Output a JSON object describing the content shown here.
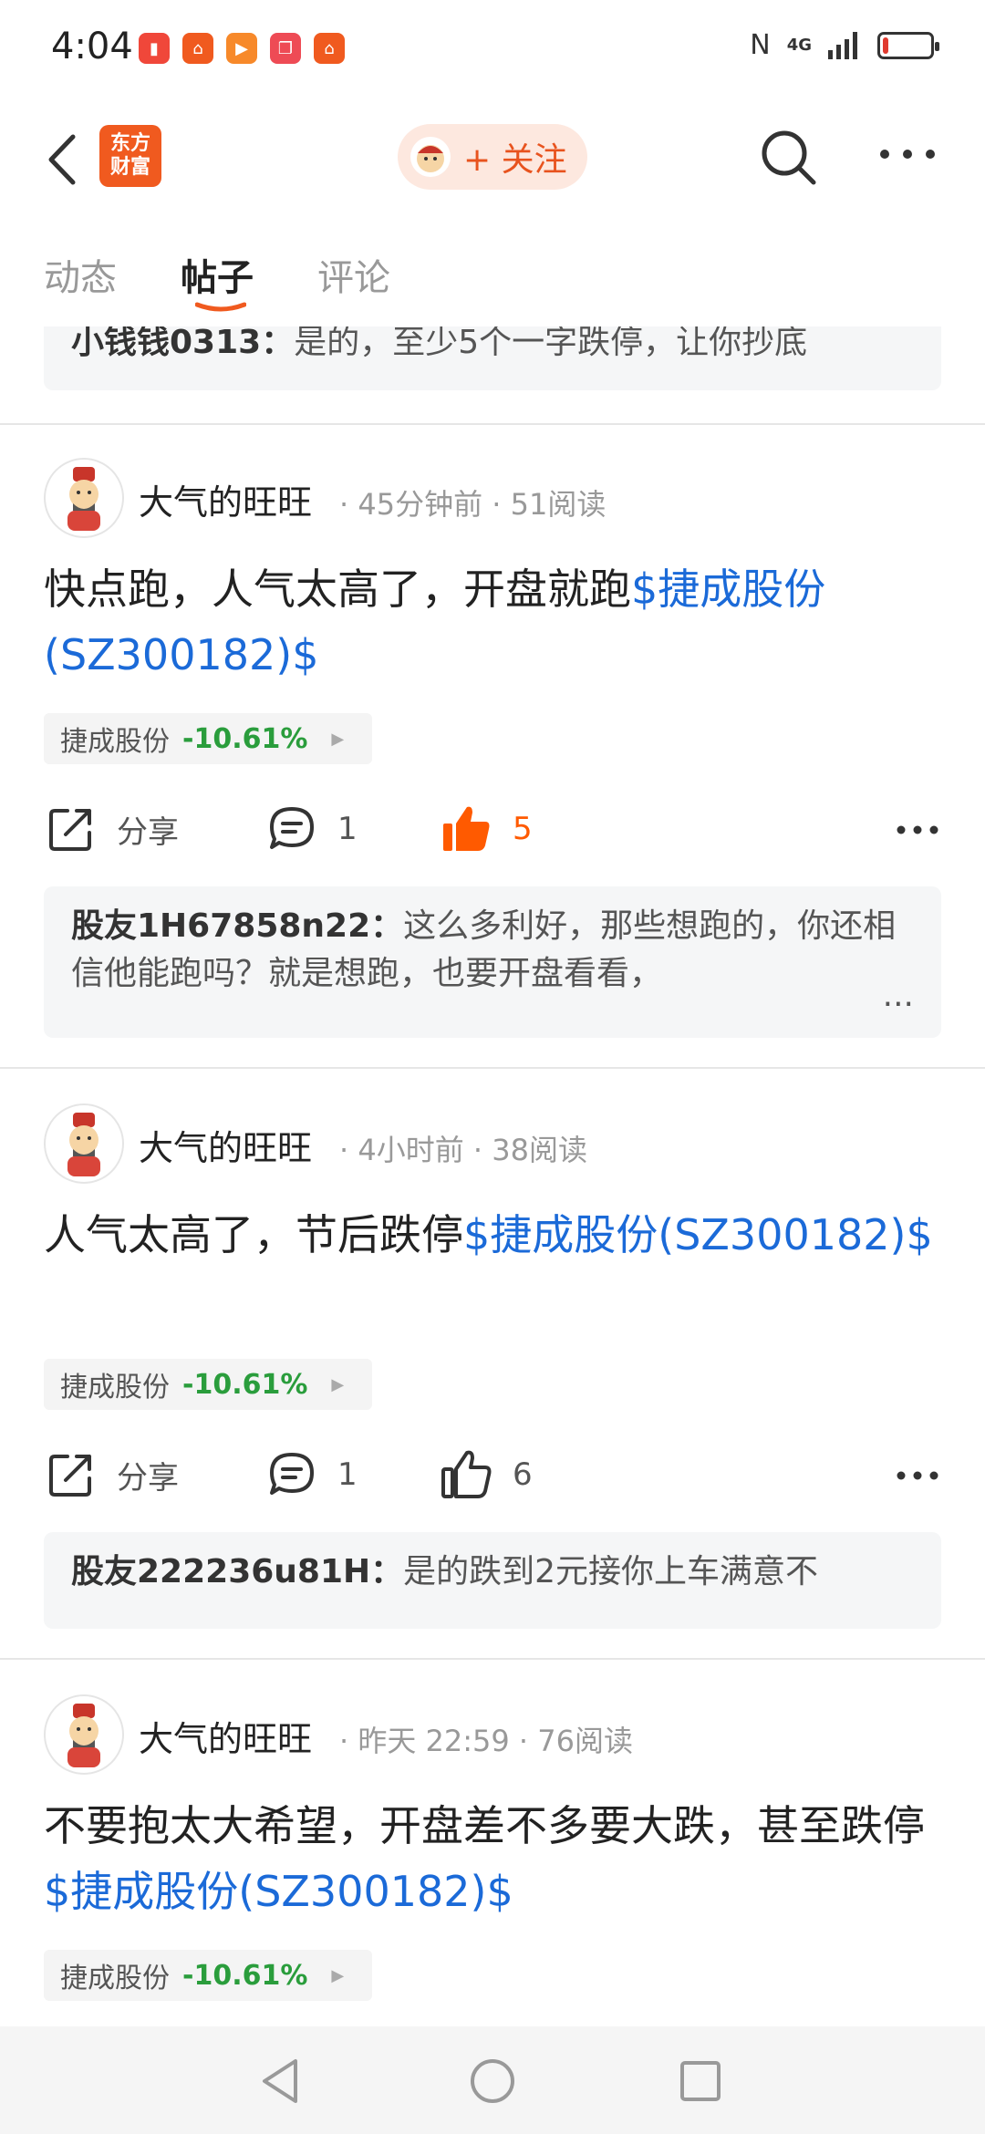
{
  "status_bar": {
    "time": "4:04",
    "network": "4G",
    "battery_level": 0.12
  },
  "header": {
    "logo_line1": "东方",
    "logo_line2": "财富",
    "follow_label": "+ 关注"
  },
  "tabs": [
    "动态",
    "帖子",
    "评论"
  ],
  "top_comment": {
    "user": "小钱钱0313：",
    "text": "是的，至少5个一字跌停，让你抄底"
  },
  "posts": [
    {
      "author": "大气的旺旺",
      "time": "45分钟前",
      "reads": "51阅读",
      "text": "快点跑，人气太高了，开盘就跑",
      "link": "$捷成股份(SZ300182)$",
      "stock_name": "捷成股份",
      "stock_change": "-10.61%",
      "share_label": "分享",
      "comments": "1",
      "likes": "5",
      "liked": true,
      "reply_user": "股友1H67858n22：",
      "reply_text": "这么多利好，那些想跑的，你还相信他能跑吗？就是想跑，也要开盘看看，",
      "reply_more": "..."
    },
    {
      "author": "大气的旺旺",
      "time": "4小时前",
      "reads": "38阅读",
      "text": "人气太高了，节后跌停",
      "link": "$捷成股份(SZ300182)$",
      "stock_name": "捷成股份",
      "stock_change": "-10.61%",
      "share_label": "分享",
      "comments": "1",
      "likes": "6",
      "liked": false,
      "reply_user": "股友222236u81H：",
      "reply_text": "是的跌到2元接你上车满意不"
    },
    {
      "author": "大气的旺旺",
      "time": "昨天 22:59",
      "reads": "76阅读",
      "text": "不要抱太大希望，开盘差不多要大跌，甚至跌停",
      "link": "$捷成股份(SZ300182)$",
      "stock_name": "捷成股份",
      "stock_change": "-10.61%"
    }
  ],
  "colors": {
    "brand": "#f05a1f",
    "link": "#1b6ad8",
    "down": "#2a9d3c",
    "liked": "#ff5a00"
  }
}
